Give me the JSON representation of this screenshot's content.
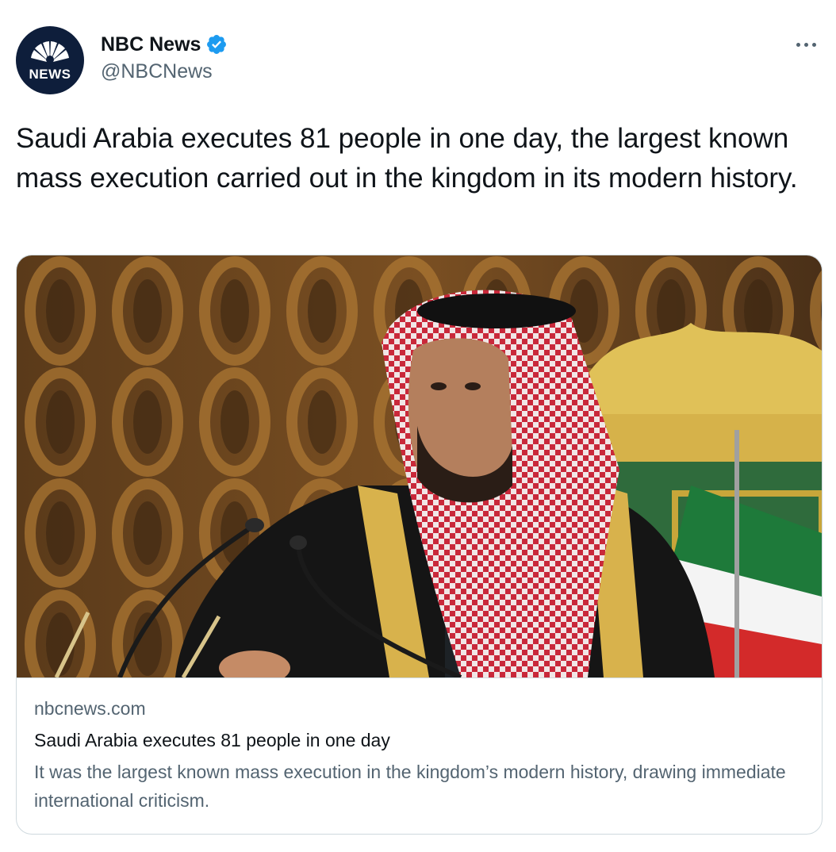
{
  "author": {
    "display_name": "NBC News",
    "handle": "@NBCNews",
    "avatar_text": "NEWS",
    "verified": true
  },
  "tweet": {
    "text": "Saudi Arabia executes 81 people in one day, the largest known mass execution carried out in the kingdom in its modern history."
  },
  "card": {
    "domain": "nbcnews.com",
    "title": "Saudi Arabia executes 81 people in one day",
    "description": "It was the largest known mass execution in the kingdom’s modern history, drawing immediate international criticism."
  },
  "icons": {
    "verified": "verified-badge-icon",
    "more": "more-options-icon",
    "avatar_logo": "peacock-logo-icon"
  },
  "colors": {
    "text_primary": "#0f1419",
    "text_secondary": "#536471",
    "verified_blue": "#1d9bf0",
    "card_border": "#cfd9de",
    "avatar_bg": "#0e1e3b"
  }
}
